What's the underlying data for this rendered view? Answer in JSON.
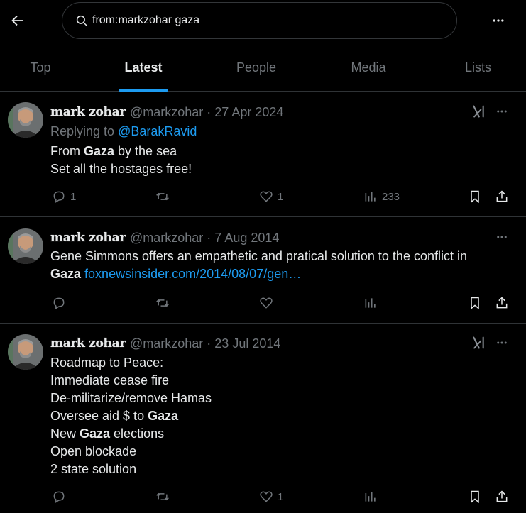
{
  "search": {
    "query": "from:markzohar gaza"
  },
  "tabs": [
    {
      "label": "Top"
    },
    {
      "label": "Latest"
    },
    {
      "label": "People"
    },
    {
      "label": "Media"
    },
    {
      "label": "Lists"
    }
  ],
  "active_tab": "Latest",
  "posts": [
    {
      "author": "mark zohar",
      "handle": "@markzohar",
      "separator": "·",
      "date": "27 Apr 2024",
      "reply_prefix": "Replying to",
      "reply_mention": "@BarakRavid",
      "lines": [
        {
          "before": "From ",
          "bold": "Gaza",
          "after": " by the sea"
        },
        {
          "before": "Set all the hostages free!",
          "bold": "",
          "after": ""
        }
      ],
      "replies": "1",
      "reposts": "",
      "likes": "1",
      "views": "233",
      "has_grok": true
    },
    {
      "author": "mark zohar",
      "handle": "@markzohar",
      "separator": "·",
      "date": "7 Aug 2014",
      "lines": [
        {
          "before": "Gene Simmons offers an empathetic and pratical solution to the conflict in",
          "bold": "",
          "after": ""
        }
      ],
      "line2_bold": "Gaza",
      "link": "foxnewsinsider.com/2014/08/07/gen…",
      "replies": "",
      "reposts": "",
      "likes": "",
      "views": "",
      "has_grok": false
    },
    {
      "author": "mark zohar",
      "handle": "@markzohar",
      "separator": "·",
      "date": "23 Jul 2014",
      "lines": [
        {
          "before": "Roadmap to Peace:",
          "bold": "",
          "after": ""
        },
        {
          "before": "Immediate cease fire",
          "bold": "",
          "after": ""
        },
        {
          "before": "De-militarize/remove Hamas",
          "bold": "",
          "after": ""
        },
        {
          "before": "Oversee aid $ to ",
          "bold": "Gaza",
          "after": ""
        },
        {
          "before": "New ",
          "bold": "Gaza",
          "after": " elections"
        },
        {
          "before": "Open blockade",
          "bold": "",
          "after": ""
        },
        {
          "before": "2 state solution",
          "bold": "",
          "after": ""
        }
      ],
      "replies": "",
      "reposts": "",
      "likes": "1",
      "views": "",
      "has_grok": true
    }
  ],
  "colors": {
    "background": "#000000",
    "text": "#e7e9ea",
    "muted": "#71767b",
    "accent": "#1d9bf0",
    "border": "#2f3336"
  },
  "icons": [
    "back-arrow-icon",
    "search-icon",
    "more-icon",
    "grok-icon",
    "reply-icon",
    "repost-icon",
    "like-icon",
    "views-icon",
    "bookmark-icon",
    "share-icon"
  ]
}
